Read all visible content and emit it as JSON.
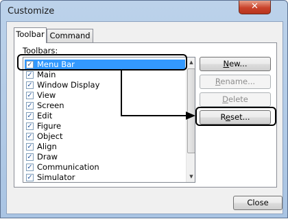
{
  "window": {
    "title": "Customize",
    "close_glyph": "✕"
  },
  "tabs": [
    {
      "label": "Toolbar"
    },
    {
      "label": "Command"
    }
  ],
  "toolbars_label": "Toolbars:",
  "toolbar_items": [
    {
      "label": "Menu Bar",
      "checked": true,
      "selected": true
    },
    {
      "label": "Main",
      "checked": true
    },
    {
      "label": "Window Display",
      "checked": true
    },
    {
      "label": "View",
      "checked": true
    },
    {
      "label": "Screen",
      "checked": true
    },
    {
      "label": "Edit",
      "checked": true
    },
    {
      "label": "Figure",
      "checked": true
    },
    {
      "label": "Object",
      "checked": true
    },
    {
      "label": "Align",
      "checked": true
    },
    {
      "label": "Draw",
      "checked": true
    },
    {
      "label": "Communication",
      "checked": true
    },
    {
      "label": "Simulator",
      "checked": true
    }
  ],
  "buttons": {
    "new": {
      "pre": "",
      "key": "N",
      "post": "ew..."
    },
    "rename": {
      "pre": "",
      "key": "R",
      "post": "ename..."
    },
    "delete": {
      "pre": "",
      "key": "D",
      "post": "elete"
    },
    "reset": {
      "pre": "R",
      "key": "e",
      "post": "set..."
    },
    "close": "Close"
  },
  "scrollbar": {
    "up_glyph": "▲",
    "down_glyph": "▼"
  }
}
